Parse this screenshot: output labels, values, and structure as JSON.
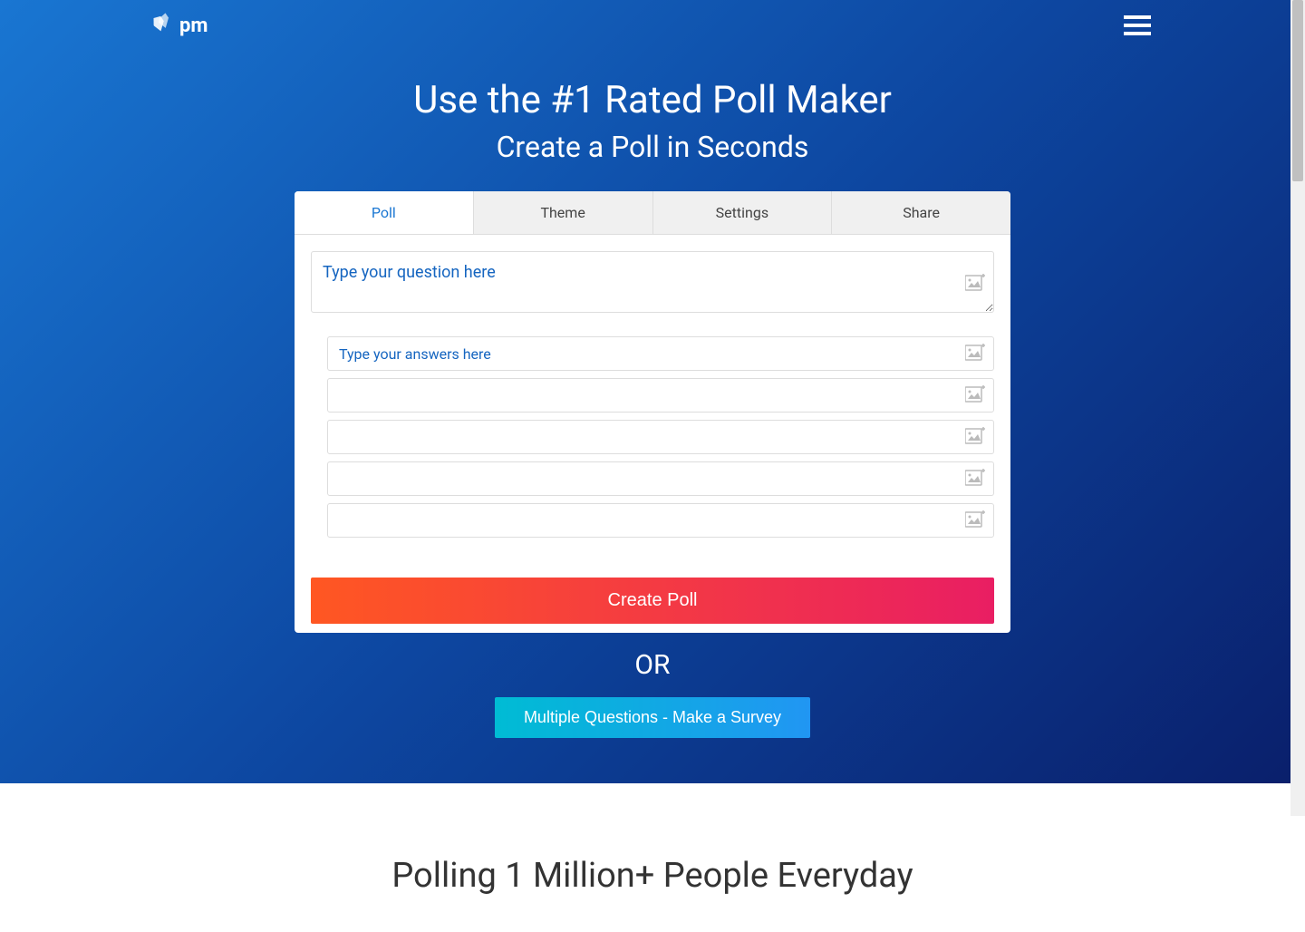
{
  "header": {
    "logo_text": "pm"
  },
  "hero": {
    "title": "Use the #1 Rated Poll Maker",
    "subtitle": "Create a Poll in Seconds"
  },
  "tabs": [
    {
      "label": "Poll",
      "active": true
    },
    {
      "label": "Theme",
      "active": false
    },
    {
      "label": "Settings",
      "active": false
    },
    {
      "label": "Share",
      "active": false
    }
  ],
  "poll": {
    "question_placeholder": "Type your question here",
    "answer_placeholder": "Type your answers here",
    "answers_count": 5,
    "create_label": "Create Poll"
  },
  "or_label": "OR",
  "survey_label": "Multiple Questions - Make a Survey",
  "footer": {
    "title": "Polling 1 Million+ People Everyday"
  }
}
